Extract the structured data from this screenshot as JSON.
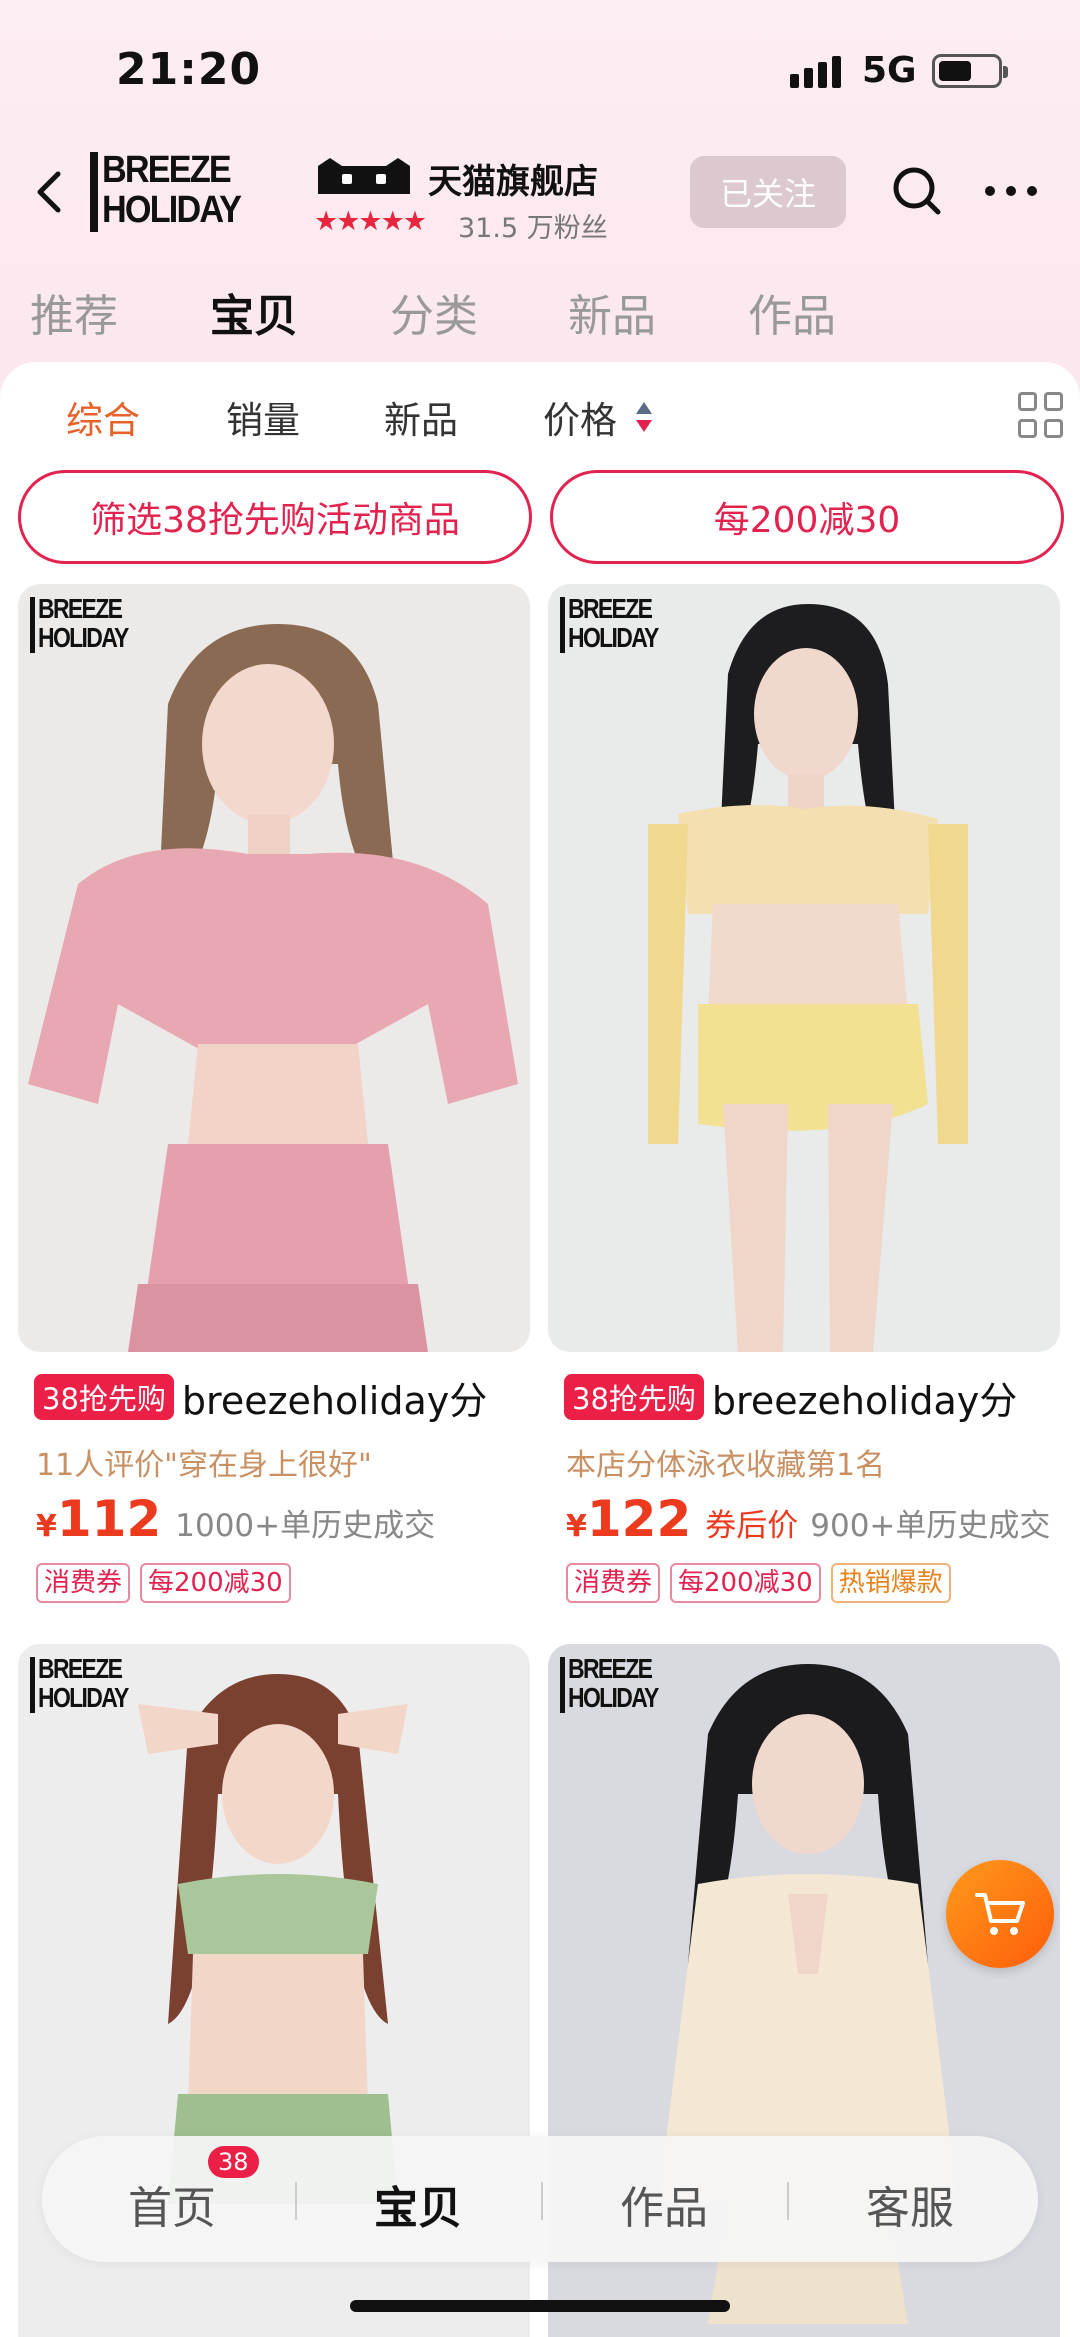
{
  "status_bar": {
    "time": "21:20",
    "network": "5G"
  },
  "shop": {
    "brand_line1": "BREEZE",
    "brand_line2": "HOLIDAY",
    "name": "天猫旗舰店",
    "rating_stars": "★★★★★",
    "fans": "31.5 万粉丝",
    "follow_label": "已关注"
  },
  "shop_tabs": [
    "推荐",
    "宝贝",
    "分类",
    "新品",
    "作品"
  ],
  "sort_bar": [
    "综合",
    "销量",
    "新品",
    "价格"
  ],
  "filters": [
    "筛选38抢先购活动商品",
    "每200减30"
  ],
  "products": [
    {
      "logo_line1": "BREEZE",
      "logo_line2": "HOLIDAY",
      "promo_tag": "38抢先购",
      "title": "breezeholiday分",
      "subtitle": "11人评价\"穿在身上很好\"",
      "currency": "¥",
      "price": "112",
      "sold": "1000+单历史成交",
      "tags": [
        "消费券",
        "每200减30"
      ]
    },
    {
      "logo_line1": "BREEZE",
      "logo_line2": "HOLIDAY",
      "promo_tag": "38抢先购",
      "title": "breezeholiday分",
      "subtitle": "本店分体泳衣收藏第1名",
      "currency": "¥",
      "price": "122",
      "after_coupon": "券后价",
      "sold": "900+单历史成交",
      "tags": [
        "消费券",
        "每200减30",
        "热销爆款"
      ]
    },
    {
      "logo_line1": "BREEZE",
      "logo_line2": "HOLIDAY"
    },
    {
      "logo_line1": "BREEZE",
      "logo_line2": "HOLIDAY"
    }
  ],
  "bottom_nav": {
    "items": [
      "首页",
      "宝贝",
      "作品",
      "客服"
    ],
    "badge": "38"
  },
  "colors": {
    "accent": "#e2234f",
    "price": "#ec3a1f",
    "sort_active": "#e7612a"
  }
}
